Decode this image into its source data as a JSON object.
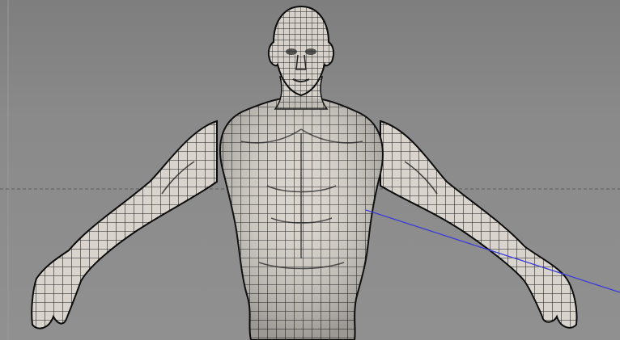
{
  "viewport": {
    "background": "#8a8a8a",
    "mesh_fill": "#d8d3cc",
    "wire_color": "#1b1b1b",
    "silhouette_color": "#0c0c0c",
    "horizon_color": "#5e5e5e",
    "axis_color": "#3b3bd6"
  }
}
